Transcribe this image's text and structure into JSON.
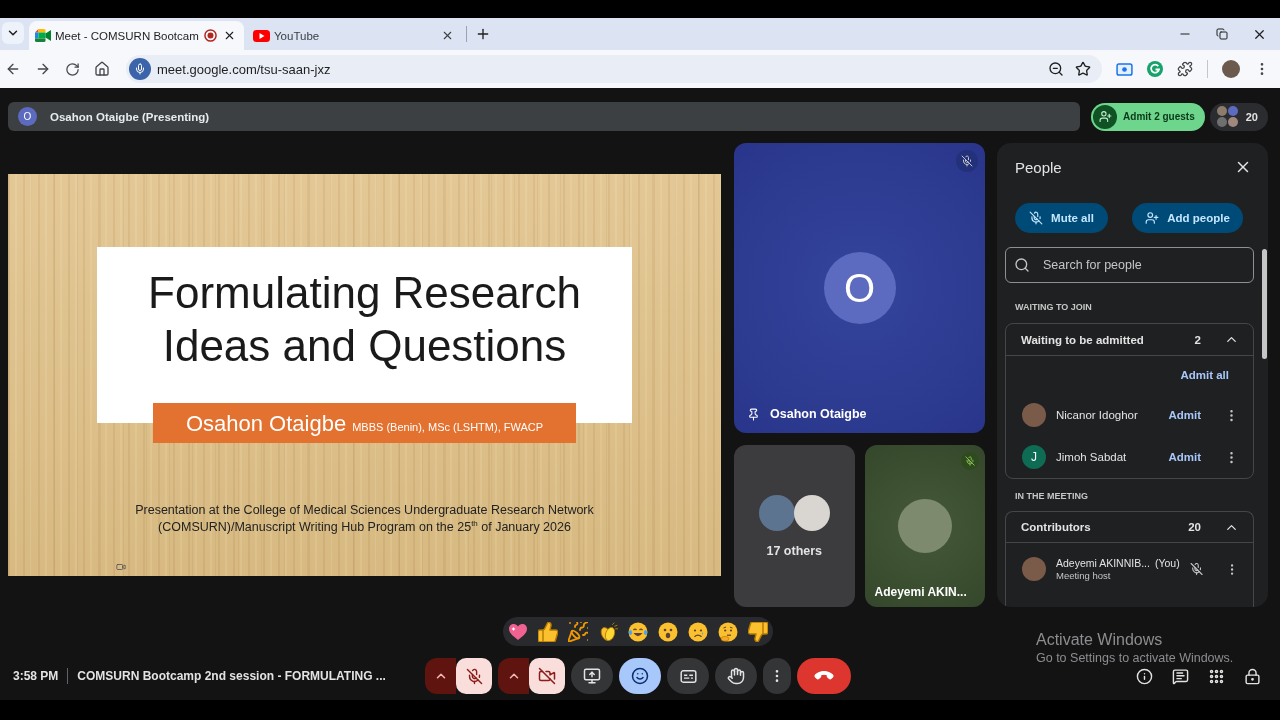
{
  "browser": {
    "tabs": [
      {
        "kind": "meet",
        "title": "Meet - COMSURN Bootcam",
        "selected": true,
        "recording": true
      },
      {
        "kind": "youtube",
        "title": "YouTube",
        "selected": false,
        "recording": false
      }
    ],
    "address": "meet.google.com/tsu-saan-jxz"
  },
  "header": {
    "presenter_initial": "O",
    "presenting_label": "Osahon Otaigbe (Presenting)",
    "admit_button": "Admit 2 guests",
    "participant_count": "20"
  },
  "slide": {
    "title": "Formulating Research Ideas and Questions",
    "presenter": "Osahon Otaigbe",
    "credentials": "MBBS (Benin), MSc (LSHTM), FWACP",
    "caption": "Presentation at the College of Medical Sciences Undergraduate Research Network (COMSURN)/Manuscript Writing Hub Program on the 25$^{th}$ of January 2026"
  },
  "tiles": [
    {
      "kind": "initial",
      "initial": "O",
      "name": "Osahon Otaigbe",
      "muted": true,
      "pinned": true
    },
    {
      "kind": "others",
      "label": "17 others"
    },
    {
      "kind": "photo",
      "name": "Adeyemi AKIN...",
      "muted": true,
      "pinned": false
    }
  ],
  "people_panel": {
    "title": "People",
    "mute_all": "Mute all",
    "add_people": "Add people",
    "search": {
      "placeholder": "Search for people"
    },
    "sections": [
      {
        "heading": "WAITING TO JOIN",
        "group": "Waiting to be admitted",
        "count": "2",
        "expanded": true,
        "action": "Admit all",
        "people": [
          {
            "kind": "photo",
            "name": "Nicanor Idoghor",
            "action": "Admit"
          },
          {
            "kind": "initial",
            "initial": "J",
            "name": "Jimoh Sabdat",
            "action": "Admit"
          }
        ]
      },
      {
        "heading": "IN THE MEETING",
        "group": "Contributors",
        "count": "20",
        "expanded": true,
        "people": [
          {
            "kind": "photo",
            "name": "Adeyemi AKINNIB...",
            "tag": "(You)",
            "role": "Meeting host",
            "muted": true
          }
        ]
      }
    ]
  },
  "reactions": [
    {
      "kind": "heart"
    },
    {
      "kind": "thumbs_up"
    },
    {
      "kind": "party"
    },
    {
      "kind": "clap"
    },
    {
      "kind": "laugh"
    },
    {
      "kind": "surprise"
    },
    {
      "kind": "sad"
    },
    {
      "kind": "thinking"
    },
    {
      "kind": "thumbs_down"
    }
  ],
  "meeting": {
    "time": "3:58 PM",
    "title": "COMSURN Bootcamp 2nd session - FORMULATING ..."
  },
  "controls": [
    {
      "kind": "microphone",
      "on": false
    },
    {
      "kind": "camera",
      "on": false
    },
    {
      "kind": "present"
    },
    {
      "kind": "reactions",
      "selected": true
    },
    {
      "kind": "captions",
      "selected": false
    },
    {
      "kind": "raise_hand",
      "selected": false
    },
    {
      "kind": "more"
    },
    {
      "kind": "leave"
    }
  ],
  "side_tools": [
    {
      "kind": "info"
    },
    {
      "kind": "chat"
    },
    {
      "kind": "activities"
    },
    {
      "kind": "host_controls"
    }
  ],
  "os_notice": {
    "title": "Activate Windows",
    "message": "Go to Settings to activate Windows."
  }
}
